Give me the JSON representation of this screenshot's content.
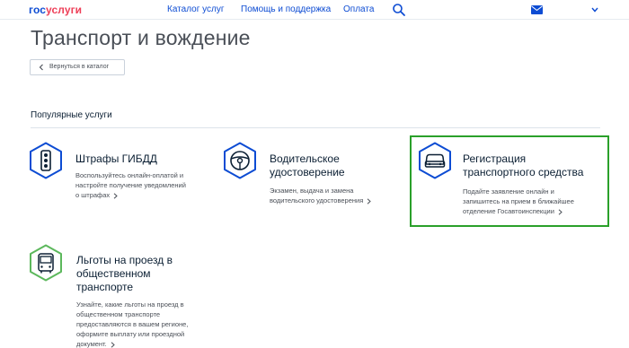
{
  "header": {
    "logo_part1": "гос",
    "logo_part2": "услуги",
    "nav": [
      "Каталог услуг",
      "Помощь и поддержка",
      "Оплата"
    ]
  },
  "page": {
    "title": "Транспорт и вождение",
    "back_label": "Вернуться в каталог",
    "section_title": "Популярные услуги"
  },
  "cards": [
    {
      "icon": "traffic-light-icon",
      "title": "Штрафы ГИБДД",
      "desc_lines": [
        "Воспользуйтесь онлайн-оплатой и",
        "настройте получение уведомлений",
        "о штрафах"
      ]
    },
    {
      "icon": "steering-wheel-icon",
      "title_lines": [
        "Водительское",
        "удостоверение"
      ],
      "desc_lines": [
        "Экзамен, выдача и замена",
        "водительского удостоверения"
      ]
    },
    {
      "icon": "car-icon",
      "title_lines": [
        "Регистрация",
        "транспортного средства"
      ],
      "desc_lines": [
        "Подайте заявление онлайн и",
        "запишитесь на прием в ближайшее",
        "отделение Госавтоинспекции"
      ]
    },
    {
      "icon": "bus-icon",
      "title_lines": [
        "Льготы на проезд в",
        "общественном",
        "транспорте"
      ],
      "desc_lines": [
        "Узнайте, какие льготы на проезд в",
        "общественном транспорте",
        "предоставляются в вашем регионе,",
        "оформите выплату или проездной",
        "документ."
      ]
    }
  ],
  "colors": {
    "primary_blue": "#0d4cd3",
    "logo_red": "#ee3f58",
    "icon_green": "#5cb85c",
    "highlight_green": "#2aa02a"
  }
}
